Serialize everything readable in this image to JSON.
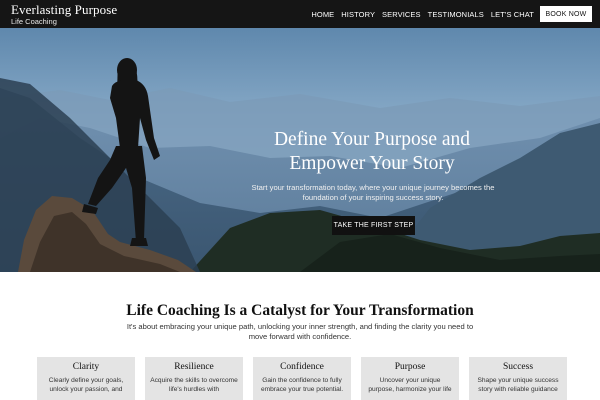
{
  "brand": {
    "name": "Everlasting Purpose",
    "tagline": "Life Coaching"
  },
  "nav": {
    "items": [
      "HOME",
      "HISTORY",
      "SERVICES",
      "TESTIMONIALS",
      "LET'S CHAT"
    ],
    "cta_label": "BOOK NOW"
  },
  "hero": {
    "title_line1": "Define Your Purpose and",
    "title_line2": "Empower Your Story",
    "subtitle": "Start your transformation today, where your unique journey becomes the foundation of your inspiring success story.",
    "cta_label": "TAKE THE FIRST STEP"
  },
  "section": {
    "title": "Life Coaching Is a Catalyst for Your Transformation",
    "subtitle": "It's about embracing your unique path, unlocking your inner strength, and finding the clarity you need to move forward with confidence."
  },
  "cards": [
    {
      "title": "Clarity",
      "text": "Clearly define your goals, unlock your passion, and"
    },
    {
      "title": "Resilience",
      "text": "Acquire the skills to overcome life's hurdles with"
    },
    {
      "title": "Confidence",
      "text": "Gain the confidence to fully embrace your true potential."
    },
    {
      "title": "Purpose",
      "text": "Uncover your unique purpose, harmonize your life"
    },
    {
      "title": "Success",
      "text": "Shape your unique success story with reliable guidance"
    }
  ],
  "colors": {
    "header_bg": "#151515",
    "cta_bg": "#111111",
    "card_bg": "#e4e4e4"
  }
}
